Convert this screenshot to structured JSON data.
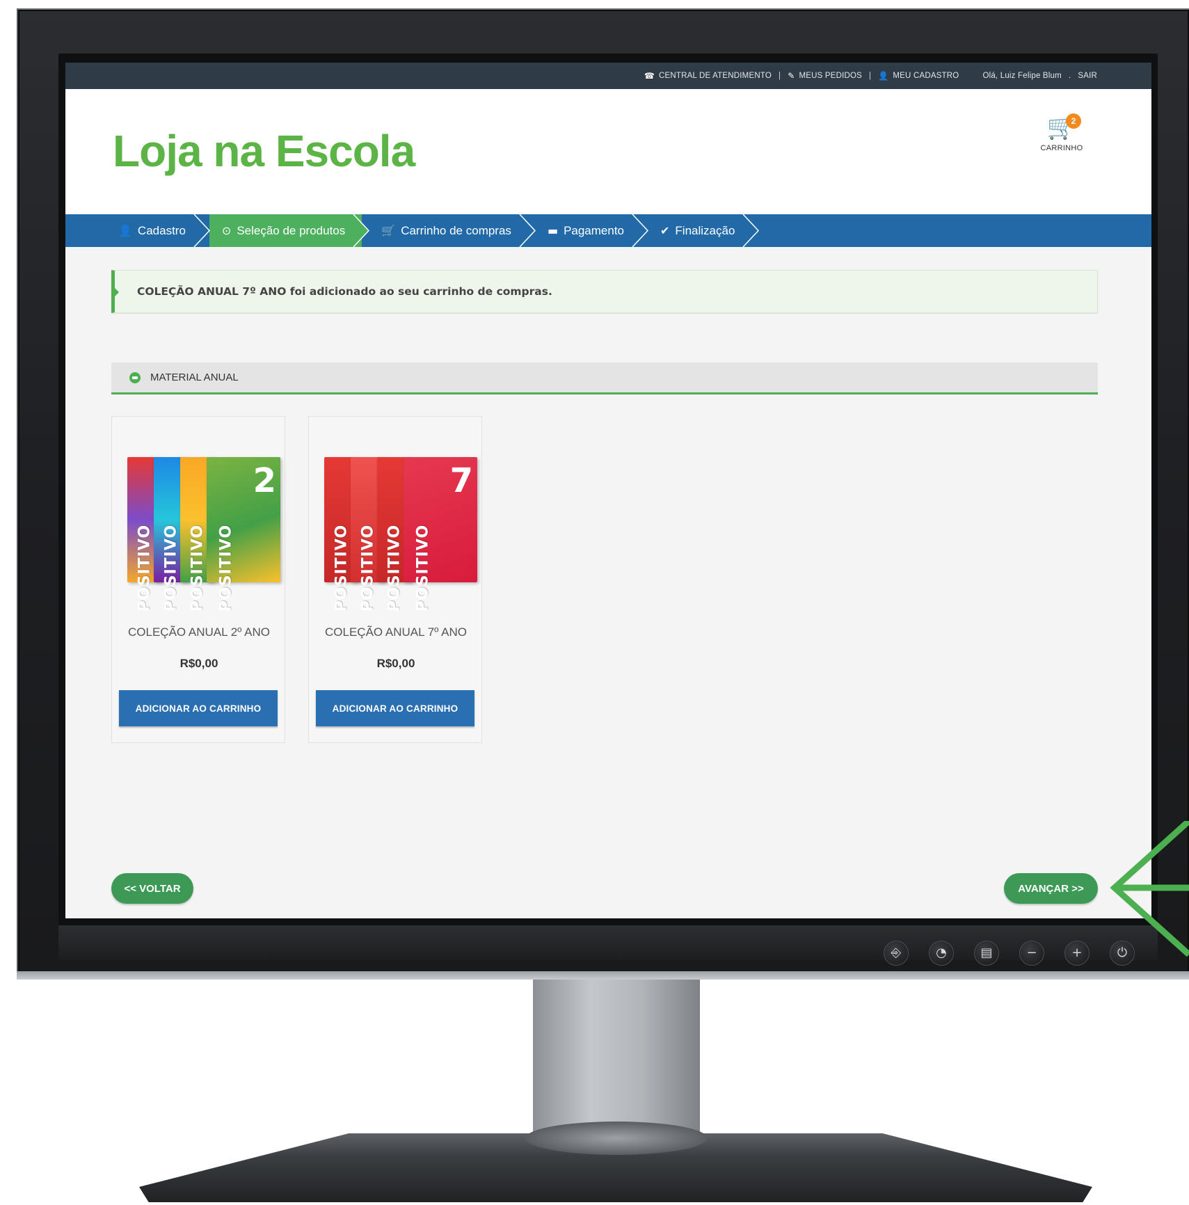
{
  "topbar": {
    "support": "CENTRAL DE ATENDIMENTO",
    "orders": "MEUS PEDIDOS",
    "account": "MEU CADASTRO",
    "greeting": "Olá, Luiz Felipe Blum",
    "logout": "SAIR",
    "separator": "|"
  },
  "header": {
    "logo": "Loja na Escola",
    "cart_label": "CARRINHO",
    "cart_count": "2"
  },
  "steps": [
    {
      "label": "Cadastro",
      "icon": "user-icon"
    },
    {
      "label": "Seleção de produtos",
      "icon": "circle-check-icon"
    },
    {
      "label": "Carrinho de compras",
      "icon": "cart-icon"
    },
    {
      "label": "Pagamento",
      "icon": "credit-card-icon"
    },
    {
      "label": "Finalização",
      "icon": "check-circle-icon"
    }
  ],
  "alert": {
    "message": "COLEÇÃO ANUAL 7º ANO foi adicionado ao seu carrinho de compras."
  },
  "section": {
    "title": "MATERIAL ANUAL"
  },
  "products": [
    {
      "name": "COLEÇÃO ANUAL 2º ANO",
      "price": "R$0,00",
      "button": "ADICIONAR AO CARRINHO",
      "cover_number": "2",
      "cover_word": "POSITIVO"
    },
    {
      "name": "COLEÇÃO ANUAL 7º ANO",
      "price": "R$0,00",
      "button": "ADICIONAR AO CARRINHO",
      "cover_number": "7",
      "cover_word": "POSITIVO"
    }
  ],
  "nav": {
    "back": "<< VOLTAR",
    "next": "AVANÇAR >>"
  },
  "colors": {
    "brand_green": "#5cb346",
    "step_bar": "#2269a8",
    "active_step": "#4db05e",
    "button_blue": "#2b6fb3",
    "badge_orange": "#f28a1e"
  }
}
